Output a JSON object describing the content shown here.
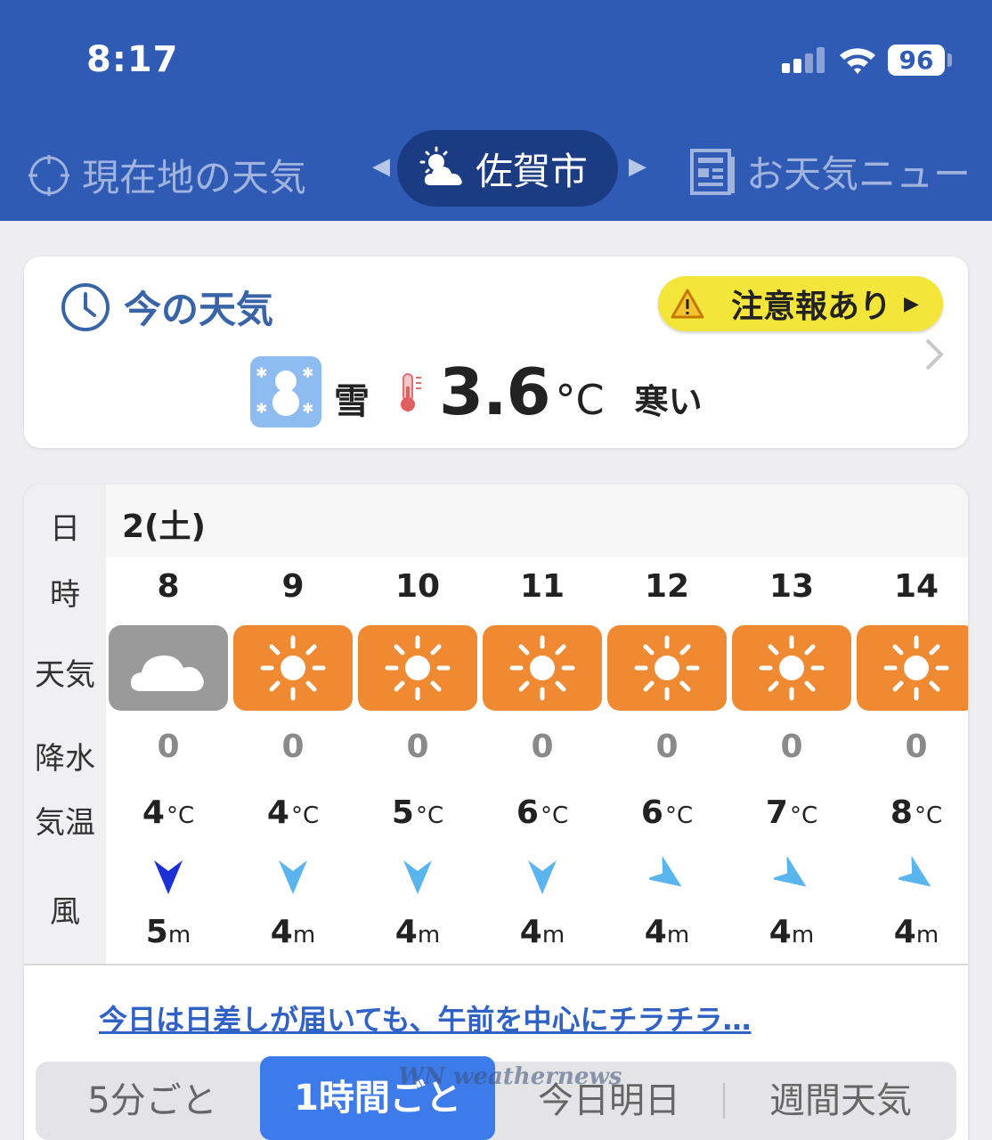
{
  "status_bar": {
    "time": "8:17",
    "battery": "96"
  },
  "nav": {
    "current_location": "現在地の天気",
    "active_city": "佐賀市",
    "news": "お天気ニュー"
  },
  "now": {
    "title": "今の天気",
    "warning": "注意報あり",
    "weather": "雪",
    "temp": "3.6",
    "temp_unit": "°C",
    "feel": "寒い"
  },
  "hourly": {
    "labels": {
      "day": "日",
      "hour": "時",
      "weather": "天気",
      "precip": "降水",
      "temp": "気温",
      "wind": "風"
    },
    "date": "2(土)",
    "temp_unit": "°C",
    "wind_unit": "m",
    "columns": [
      {
        "hour": "8",
        "weather": "cloudy",
        "precip": "0",
        "temp": "4",
        "wind": "5",
        "wind_color": "#1a2fd6",
        "wind_dir": "north"
      },
      {
        "hour": "9",
        "weather": "sunny",
        "precip": "0",
        "temp": "4",
        "wind": "4",
        "wind_color": "#5ab4ee",
        "wind_dir": "north"
      },
      {
        "hour": "10",
        "weather": "sunny",
        "precip": "0",
        "temp": "5",
        "wind": "4",
        "wind_color": "#5ab4ee",
        "wind_dir": "north"
      },
      {
        "hour": "11",
        "weather": "sunny",
        "precip": "0",
        "temp": "6",
        "wind": "4",
        "wind_color": "#5ab4ee",
        "wind_dir": "north"
      },
      {
        "hour": "12",
        "weather": "sunny",
        "precip": "0",
        "temp": "6",
        "wind": "4",
        "wind_color": "#5ab4ee",
        "wind_dir": "northwest"
      },
      {
        "hour": "13",
        "weather": "sunny",
        "precip": "0",
        "temp": "7",
        "wind": "4",
        "wind_color": "#5ab4ee",
        "wind_dir": "northwest"
      },
      {
        "hour": "14",
        "weather": "sunny",
        "precip": "0",
        "temp": "8",
        "wind": "4",
        "wind_color": "#5ab4ee",
        "wind_dir": "northwest"
      }
    ],
    "comment": "今日は日差しが届いても、午前を中心にチラチラ…"
  },
  "tabs": {
    "five_min": "5分ごと",
    "hourly": "1時間ごと",
    "today_tomorrow": "今日明日",
    "weekly": "週間天気"
  },
  "watermark": "WN weathernews"
}
